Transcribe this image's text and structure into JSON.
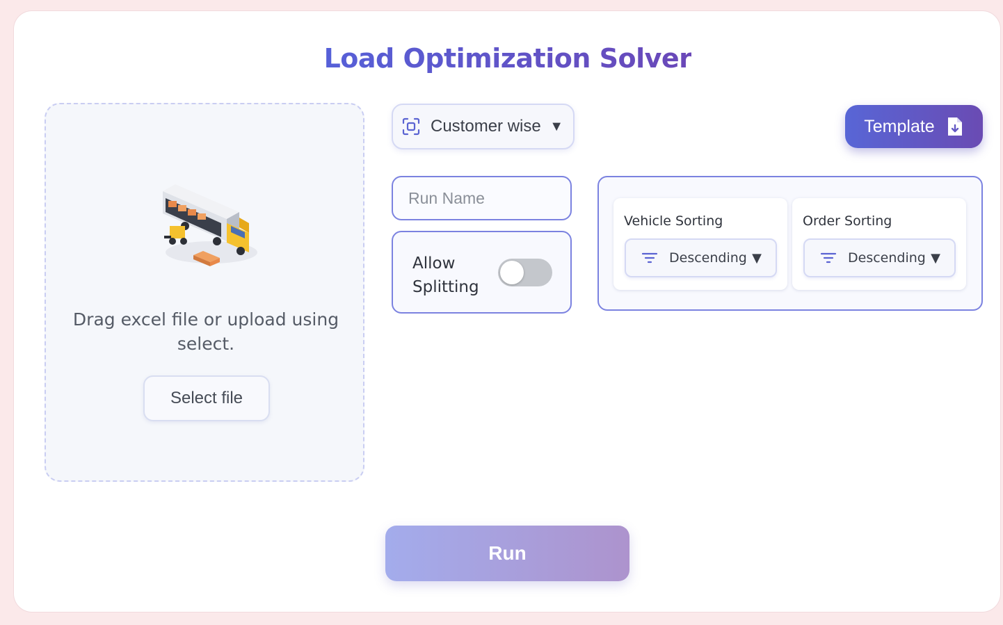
{
  "page": {
    "title": "Load Optimization Solver"
  },
  "upload": {
    "illustration": "delivery-truck-loading-illustration",
    "instructions": "Drag excel file or upload using select.",
    "select_label": "Select file"
  },
  "mode": {
    "selected": "Customer wise",
    "icon": "scan-focus-icon"
  },
  "template": {
    "label": "Template",
    "icon": "file-download-icon"
  },
  "run_name": {
    "placeholder": "Run Name",
    "value": ""
  },
  "splitting": {
    "label": "Allow Splitting",
    "enabled": false
  },
  "sorting": {
    "vehicle": {
      "title": "Vehicle Sorting",
      "selected": "Descending",
      "icon": "filter-lines-icon"
    },
    "order": {
      "title": "Order Sorting",
      "selected": "Descending",
      "icon": "filter-lines-icon"
    }
  },
  "actions": {
    "run_label": "Run"
  },
  "colors": {
    "accent_start": "#5866d6",
    "accent_end": "#6a4bb3",
    "border_accent": "#7b82e0",
    "run_disabled_start": "#a3acec",
    "run_disabled_end": "#ad93cd",
    "toggle_off": "#c4c7cc"
  }
}
